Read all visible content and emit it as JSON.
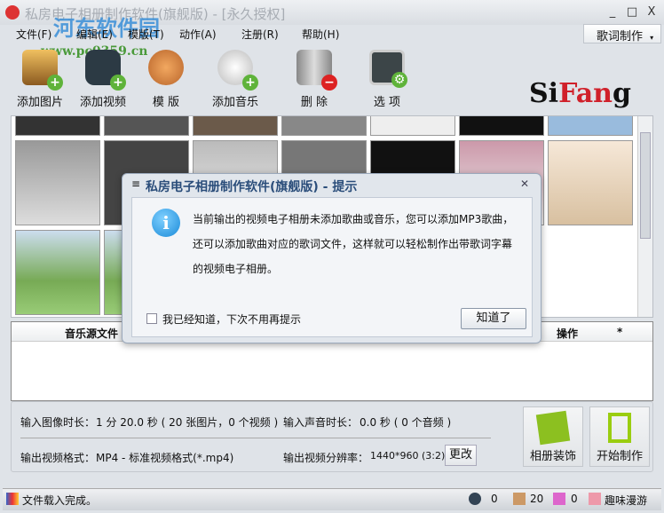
{
  "window": {
    "title": "私房电子相册制作软件(旗舰版) - [永久授权]",
    "minimize": "_",
    "maximize": "□",
    "close": "X"
  },
  "watermark": {
    "name": "河东软件园",
    "url": "www.pc0359.cn"
  },
  "menu": [
    "文件(F)",
    "编辑(E)",
    "模版(T)",
    "动作(A)",
    "注册(R)",
    "帮助(H)"
  ],
  "lyric_button": "歌词制作",
  "toolbar": [
    {
      "label": "添加图片",
      "icon": "add-picture-icon"
    },
    {
      "label": "添加视频",
      "icon": "add-video-icon"
    },
    {
      "label": "模 版",
      "icon": "palette-icon"
    },
    {
      "label": "添加音乐",
      "icon": "add-music-icon"
    },
    {
      "label": "删 除",
      "icon": "trash-icon"
    },
    {
      "label": "选 项",
      "icon": "options-icon"
    }
  ],
  "logo": {
    "pre": "Si",
    "mid": "Fan",
    "post": "g"
  },
  "table": {
    "headers": [
      "音乐源文件",
      "操作",
      "*"
    ]
  },
  "info": {
    "image_duration_label": "输入图像时长：",
    "image_duration": "1 分 20.0 秒 ( 20 张图片，0 个视频 )",
    "audio_duration_label": "输入声音时长：",
    "audio_duration": "0.0 秒 ( 0 个音频 )",
    "format_label": "输出视频格式：",
    "format": "MP4 - 标准视频格式(*.mp4)",
    "resolution_label": "输出视频分辨率：",
    "resolution": "1440*960 (3:2)",
    "change": "更改",
    "decorate": "相册装饰",
    "start": "开始制作"
  },
  "status": {
    "text": "文件载入完成。",
    "videos": "0",
    "images": "20",
    "audios": "0",
    "fun": "趣味漫游"
  },
  "dialog": {
    "title": "私房电子相册制作软件(旗舰版) - 提示",
    "close": "✕",
    "message": "当前输出的视频电子相册未添加歌曲或音乐，您可以添加MP3歌曲，还可以添加歌曲对应的歌词文件，这样就可以轻松制作出带歌词字幕的视频电子相册。",
    "checkbox": "我已经知道，下次不用再提示",
    "ok": "知道了"
  }
}
